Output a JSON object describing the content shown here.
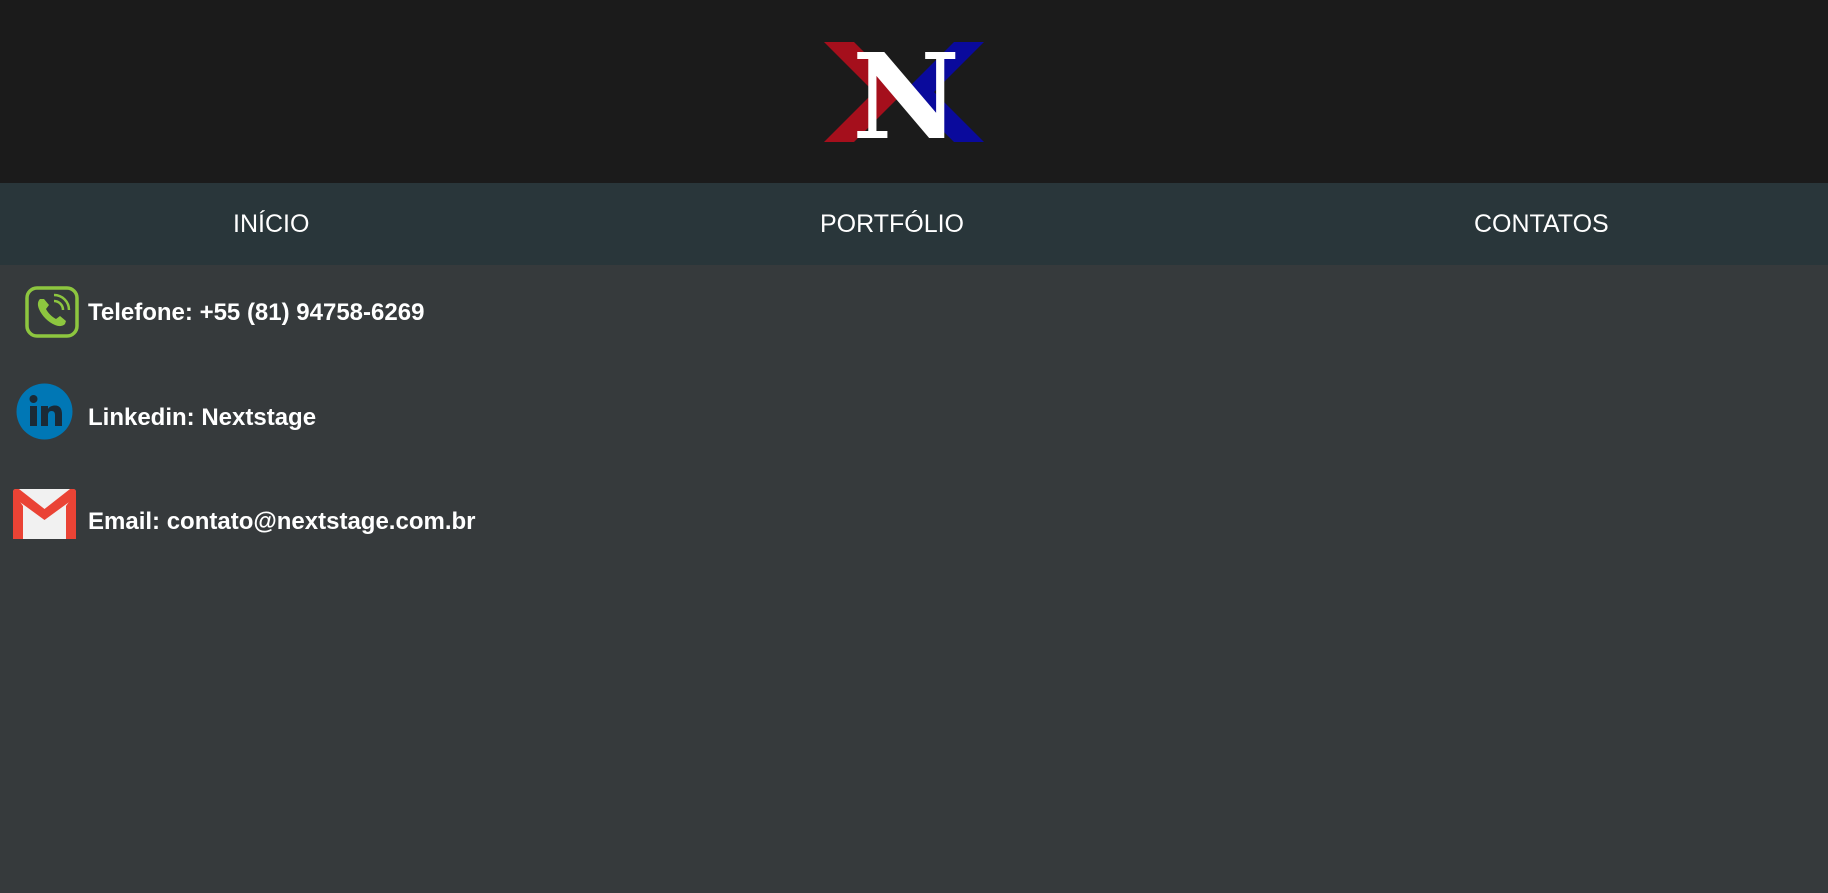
{
  "header": {
    "logo_alt": "N",
    "logo_letter": "N",
    "logo_colors": {
      "left": "#a50f1c",
      "right": "#0a0a9c",
      "letter": "#ffffff"
    }
  },
  "nav": {
    "items": [
      {
        "label": "INÍCIO"
      },
      {
        "label": "PORTFÓLIO"
      },
      {
        "label": "CONTATOS"
      }
    ]
  },
  "contacts": {
    "phone": {
      "text": "Telefone: +55 (81) 94758-6269",
      "icon": "phone-icon"
    },
    "linkedin": {
      "text": "Linkedin: Nextstage",
      "icon": "linkedin-icon"
    },
    "email": {
      "text": "Email: contato@nextstage.com.br",
      "icon": "gmail-icon"
    }
  },
  "colors": {
    "header_bg": "#1b1b1b",
    "nav_bg": "#29363a",
    "page_bg": "#363a3c",
    "phone_green": "#8dc63f",
    "linkedin_blue": "#0077b5",
    "gmail_red": "#ea4335"
  }
}
